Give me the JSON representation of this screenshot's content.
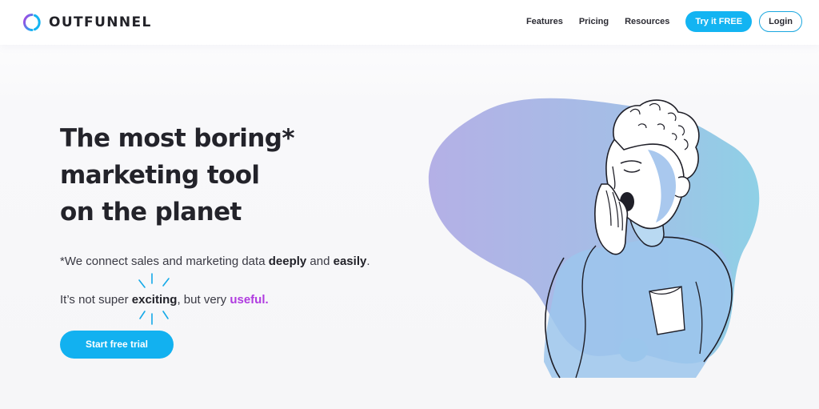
{
  "brand": {
    "name": "OUTFUNNEL"
  },
  "nav": {
    "features": "Features",
    "pricing": "Pricing",
    "resources": "Resources",
    "try_free": "Try it FREE",
    "login": "Login"
  },
  "hero": {
    "title_line1": "The most boring*",
    "title_line2": "marketing tool",
    "title_line3": "on the planet",
    "sub1_prefix": "*We connect sales and marketing data ",
    "sub1_deeply": "deeply",
    "sub1_and": " and ",
    "sub1_easily": "easily",
    "sub1_suffix": ".",
    "sub2_prefix": "It’s not super ",
    "sub2_exciting": "exciting",
    "sub2_middle": ", but very ",
    "sub2_useful": "useful.",
    "cta": "Start free trial"
  },
  "colors": {
    "accent": "#13b4f2",
    "purple": "#b03be0",
    "blob_left": "#b4b0e6",
    "blob_right": "#8fd0e6"
  },
  "icons": {
    "logo": "outfunnel-ring-logo",
    "sparkle": "sparkle-lines",
    "illustration": "yawning-person"
  }
}
